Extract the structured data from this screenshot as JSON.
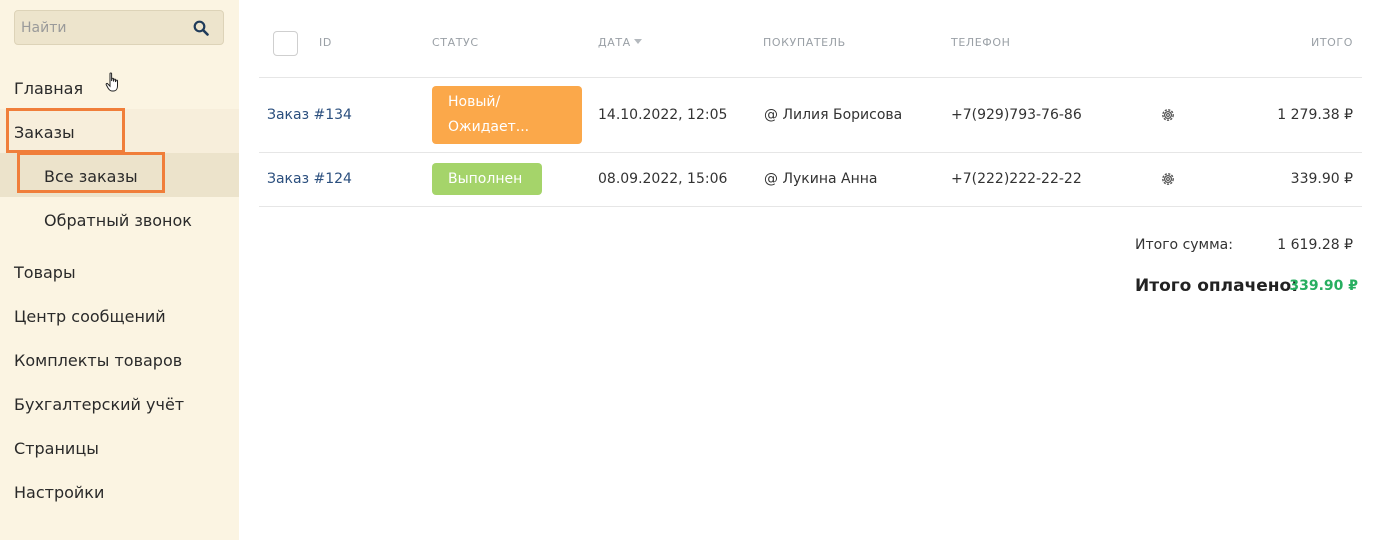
{
  "search": {
    "placeholder": "Найти"
  },
  "sidebar": {
    "items": [
      {
        "label": "Главная"
      },
      {
        "label": "Заказы"
      },
      {
        "label": "Все заказы"
      },
      {
        "label": "Обратный звонок"
      },
      {
        "label": "Товары"
      },
      {
        "label": "Центр сообщений"
      },
      {
        "label": "Комплекты товаров"
      },
      {
        "label": "Бухгалтерский учёт"
      },
      {
        "label": "Страницы"
      },
      {
        "label": "Настройки"
      }
    ]
  },
  "table": {
    "headers": {
      "id": "ID",
      "status": "СТАТУС",
      "date": "ДАТА",
      "buyer": "ПОКУПАТЕЛЬ",
      "phone": "ТЕЛЕФОН",
      "total": "ИТОГО"
    },
    "rows": [
      {
        "order": "Заказ #134",
        "status": "Новый/\nОжидает...",
        "status_color": "#fba84a",
        "date": "14.10.2022, 12:05",
        "buyer": "@ Лилия Борисова",
        "phone": "+7(929)793-76-86",
        "total": "1 279.38 ₽"
      },
      {
        "order": "Заказ #124",
        "status": "Выполнен",
        "status_color": "#a5d46a",
        "date": "08.09.2022, 15:06",
        "buyer": "@ Лукина Анна",
        "phone": "+7(222)222-22-22",
        "total": "339.90 ₽"
      }
    ]
  },
  "summary": {
    "sum_label": "Итого сумма:",
    "sum_value": "1 619.28 ₽",
    "paid_label": "Итого оплачено:",
    "paid_value": "339.90 ₽",
    "paid_color": "#27ae60"
  },
  "colors": {
    "highlight": "#f07e3a",
    "sidebar_bg": "#fbf4e2",
    "link": "#2b4f7e"
  }
}
